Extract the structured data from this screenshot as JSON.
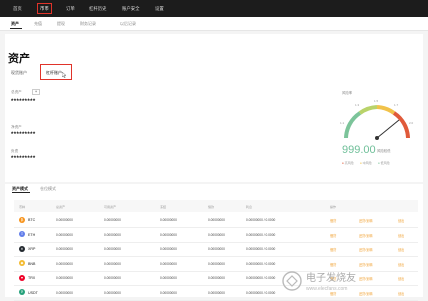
{
  "topnav": {
    "items": [
      "首页",
      "币币",
      "订单",
      "杠杆历史",
      "账户安全",
      "设置"
    ]
  },
  "subnav": {
    "items": [
      "资产",
      "充值",
      "提现",
      "财务记录",
      "以后记录"
    ]
  },
  "page_title": "资产",
  "tabs": [
    "现货账户",
    "杠杆账户"
  ],
  "assets": {
    "total_label": "总资产",
    "total_value": "*********",
    "net_label": "净资产",
    "net_value": "*********",
    "debt_label": "负债",
    "debt_value": "*********"
  },
  "risk": {
    "label": "风险率",
    "value": "999.00",
    "suffix": "风险较低",
    "legend": [
      "高风险",
      "中风险",
      "低风险"
    ],
    "ticks": [
      "1.1",
      "1.3",
      "1.5",
      "1.7",
      "2.0"
    ]
  },
  "section": {
    "modes": [
      "资产模式",
      "仓位模式"
    ]
  },
  "table": {
    "headers": [
      "币种",
      "总资产",
      "可用资产",
      "冻结",
      "借款",
      "利息",
      "最大可借/总借",
      "操作"
    ],
    "rows": [
      {
        "coin": "BTC",
        "c1": "0.00000000",
        "c2": "0.00000000",
        "c3": "0.00000000",
        "c4": "0.00000000",
        "c5": "0.00000000 / 0.0000",
        "a1": "借贷",
        "a2": "还贷/划转",
        "a3": "划出"
      },
      {
        "coin": "ETH",
        "c1": "0.00000000",
        "c2": "0.00000000",
        "c3": "0.00000000",
        "c4": "0.00000000",
        "c5": "0.00000000 / 0.0000",
        "a1": "借贷",
        "a2": "还贷/划转",
        "a3": "划出"
      },
      {
        "coin": "XRP",
        "c1": "0.00000000",
        "c2": "0.00000000",
        "c3": "0.00000000",
        "c4": "0.00000000",
        "c5": "0.00000000 / 0.0000",
        "a1": "借贷",
        "a2": "还贷/划转",
        "a3": "划出"
      },
      {
        "coin": "BNB",
        "c1": "0.00000000",
        "c2": "0.00000000",
        "c3": "0.00000000",
        "c4": "0.00000000",
        "c5": "0.00000000 / 0.0000",
        "a1": "借贷",
        "a2": "还贷/划转",
        "a3": "划出"
      },
      {
        "coin": "TRX",
        "c1": "0.00000000",
        "c2": "0.00000000",
        "c3": "0.00000000",
        "c4": "0.00000000",
        "c5": "0.00000000 / 0.0000",
        "a1": "借贷",
        "a2": "还贷/划转",
        "a3": "划出"
      },
      {
        "coin": "USDT",
        "c1": "0.00000000",
        "c2": "0.00000000",
        "c3": "0.00000000",
        "c4": "0.00000000",
        "c5": "0.00000000 / 0.0000",
        "a1": "借贷",
        "a2": "还贷/划转",
        "a3": "划出"
      }
    ]
  },
  "watermark": "电子发烧友",
  "watermark_url": "www.elecfans.com",
  "colors": {
    "accent": "#e0332a",
    "action": "#f0a030",
    "risk_low": "#6fbf99"
  }
}
